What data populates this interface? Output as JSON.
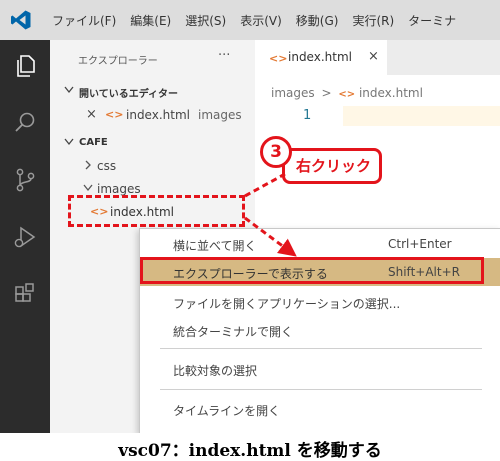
{
  "menubar": {
    "items": [
      "ファイル(F)",
      "編集(E)",
      "選択(S)",
      "表示(V)",
      "移動(G)",
      "実行(R)",
      "ターミナ"
    ]
  },
  "activity_icons": [
    "explorer-icon",
    "search-icon",
    "source-control-icon",
    "run-debug-icon",
    "extensions-icon"
  ],
  "sidebar": {
    "title": "エクスプローラー",
    "more": "···",
    "open_editors": {
      "header": "開いているエディター",
      "item_close": "×",
      "item_file": "index.html",
      "item_folder": "images"
    },
    "workspace": {
      "header": "CAFE",
      "css_folder": "css",
      "images_folder": "images",
      "file": "index.html"
    }
  },
  "editor": {
    "tab_label": "index.html",
    "tab_close": "×",
    "breadcrumb_folder": "images",
    "breadcrumb_sep": ">",
    "breadcrumb_file": "index.html",
    "line_number": "1"
  },
  "context_menu": {
    "items": [
      {
        "label": "横に並べて開く",
        "shortcut": "Ctrl+Enter"
      },
      {
        "label": "エクスプローラーで表示する",
        "shortcut": "Shift+Alt+R",
        "highlighted": true
      },
      {
        "label": "ファイルを開くアプリケーションの選択...",
        "shortcut": ""
      },
      {
        "label": "統合ターミナルで開く",
        "shortcut": ""
      },
      {
        "label": "比較対象の選択",
        "shortcut": ""
      },
      {
        "label": "タイムラインを開く",
        "shortcut": ""
      }
    ]
  },
  "annotation": {
    "step": "3",
    "action": "右クリック",
    "color": "#e3141b"
  },
  "caption": "vsc07：index.html を移動する",
  "colors": {
    "activity_bar": "#2c2c2c",
    "menubar": "#dddddd",
    "highlight": "#d6b983",
    "html_icon": "#e37933",
    "vscode_blue": "#0065a9"
  }
}
